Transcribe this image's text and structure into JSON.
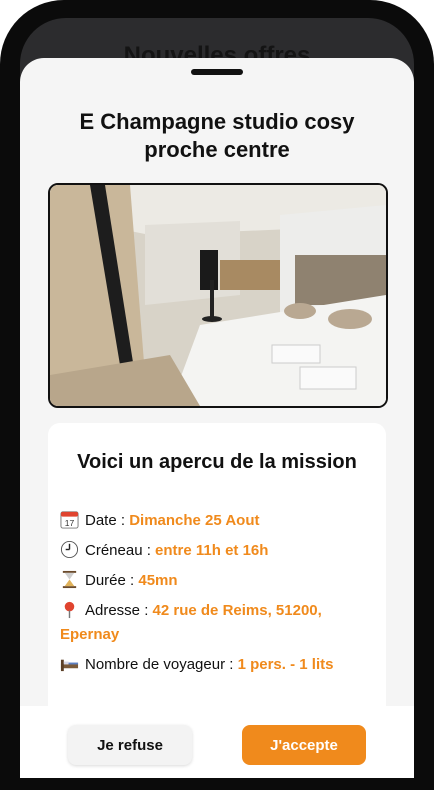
{
  "background": {
    "header_title": "Nouvelles offres"
  },
  "listing": {
    "title": "E Champagne studio cosy proche centre"
  },
  "mission": {
    "heading": "Voici un apercu de la mission",
    "date_label": "Date : ",
    "date_value": "Dimanche 25 Aout",
    "slot_label": "Créneau : ",
    "slot_value": "entre 11h et 16h",
    "duration_label": "Durée : ",
    "duration_value": "45mn",
    "address_label": "Adresse : ",
    "address_value": "42 rue de Reims, 51200, Epernay",
    "guests_label": "Nombre de voyageur : ",
    "guests_value": "1 pers. - 1 lits"
  },
  "actions": {
    "refuse_label": "Je refuse",
    "accept_label": "J'accepte"
  },
  "colors": {
    "accent": "#f08a1c",
    "sheet_bg": "#f5f5f5",
    "phone": "#0b0b0b"
  },
  "icons": [
    "calendar-icon",
    "clock-icon",
    "hourglass-icon",
    "pin-icon",
    "bed-icon"
  ]
}
